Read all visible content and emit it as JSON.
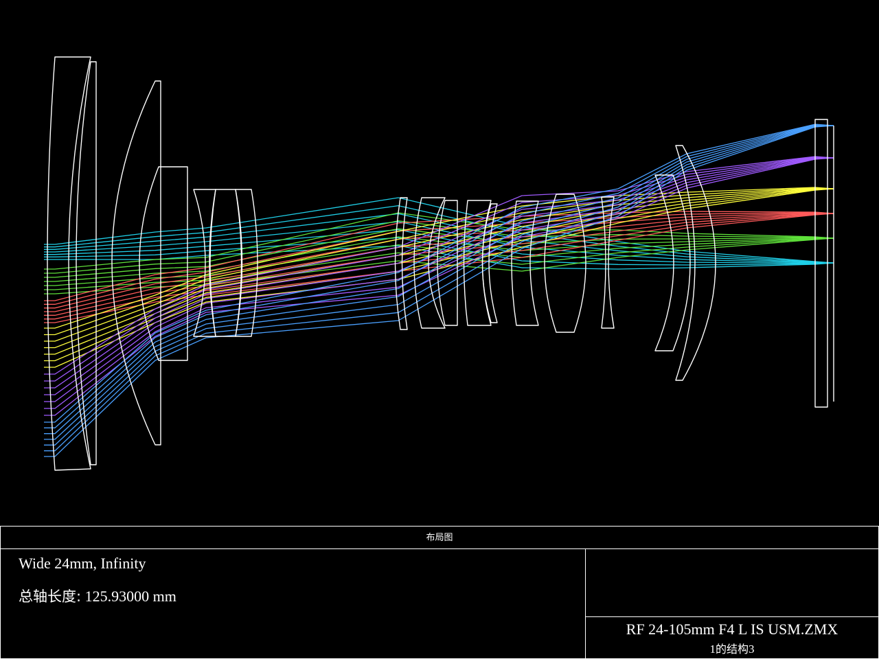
{
  "diagram": {
    "type": "optical_layout",
    "image_plane_colors": [
      "#1fcfe8",
      "#5ee03a",
      "#ff5a5a",
      "#ffff3c",
      "#a05aff",
      "#4aa0ff"
    ],
    "lens_outline_color": "#ffffff",
    "background": "#000000"
  },
  "frame": {
    "title": "布局图",
    "notes_line1": "Wide 24mm, Infinity",
    "total_length_label": "总轴长度:",
    "total_length_value": "125.93000 mm",
    "file_name": "RF 24-105mm F4 L IS USM.ZMX",
    "config_num": "1",
    "config_text": "的结构",
    "config_total": "3"
  }
}
